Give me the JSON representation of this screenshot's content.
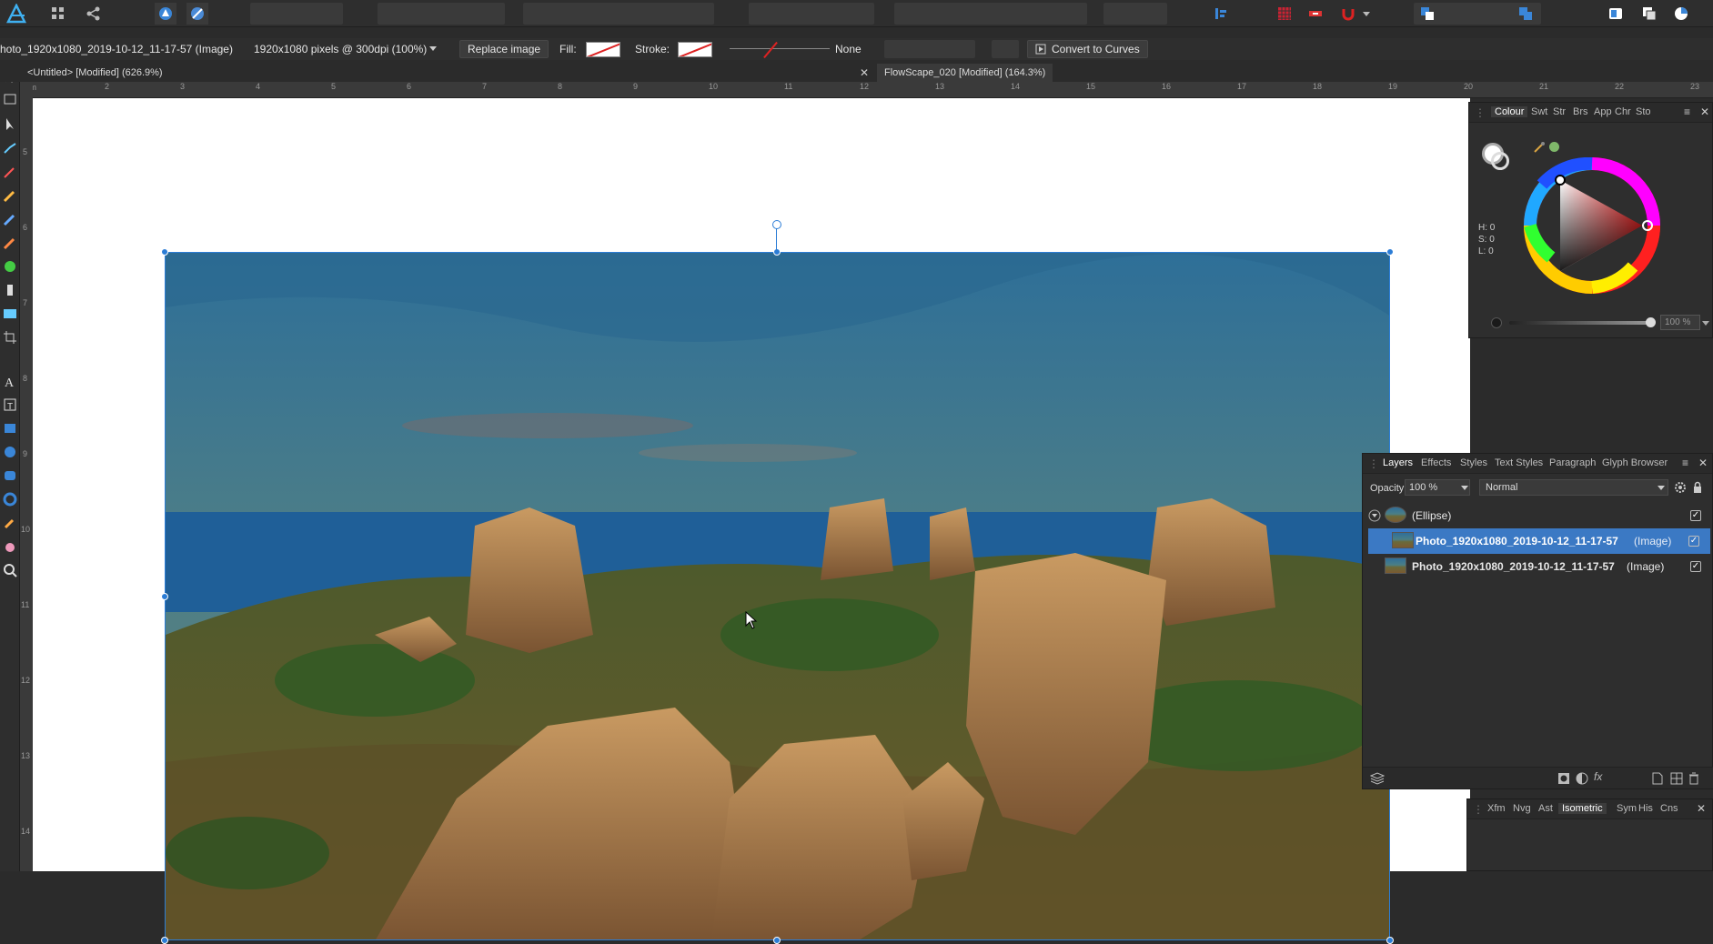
{
  "colors": {
    "accent": "#2c7dd6",
    "selected_row": "#3b79c4",
    "ui_bg": "#2e2e2e"
  },
  "toolbar": {
    "icons": [
      "affinity-logo-icon",
      "grid-menu-icon",
      "share-icon",
      "persona-designer-icon",
      "persona-pixel-icon"
    ]
  },
  "context": {
    "object_name": "hoto_1920x1080_2019-10-12_11-17-57 (Image)",
    "dimensions": "1920x1080 pixels @ 300dpi (100%)",
    "replace_label": "Replace image",
    "fill_label": "Fill:",
    "stroke_label": "Stroke:",
    "stroke_style": "None",
    "convert_label": "Convert to Curves"
  },
  "tabs": [
    {
      "label": "<Untitled> [Modified] (626.9%)"
    },
    {
      "label": "FlowScape_020 [Modified] (164.3%)"
    }
  ],
  "ruler": {
    "h_ticks": [
      "2",
      "3",
      "4",
      "5",
      "6",
      "7",
      "8",
      "9",
      "10",
      "11",
      "12",
      "13",
      "14",
      "15",
      "16",
      "17",
      "18",
      "19",
      "20",
      "21",
      "22",
      "23"
    ],
    "unit": "cm",
    "v_ticks": [
      "5",
      "6",
      "7",
      "8",
      "9",
      "10",
      "11",
      "12",
      "13",
      "14"
    ]
  },
  "colour_panel": {
    "tabs": [
      "Colour",
      "Swt",
      "Str",
      "Brs",
      "App",
      "Chr",
      "Sto"
    ],
    "h": "H: 0",
    "s": "S: 0",
    "l": "L: 0",
    "opacity": "100 %"
  },
  "layers_panel": {
    "tabs": [
      "Layers",
      "Effects",
      "Styles",
      "Text Styles",
      "Paragraph",
      "Glyph Browser"
    ],
    "opacity_label": "Opacity:",
    "opacity_value": "100 %",
    "blend_mode": "Normal",
    "layers": [
      {
        "name": "(Ellipse)",
        "type": ""
      },
      {
        "name": "Photo_1920x1080_2019-10-12_11-17-57",
        "type": "(Image)"
      },
      {
        "name": "Photo_1920x1080_2019-10-12_11-17-57",
        "type": "(Image)"
      }
    ]
  },
  "transform_panel": {
    "tabs": [
      "Xfm",
      "Nvg",
      "Ast",
      "Isometric",
      "Sym",
      "His",
      "Cns"
    ]
  }
}
